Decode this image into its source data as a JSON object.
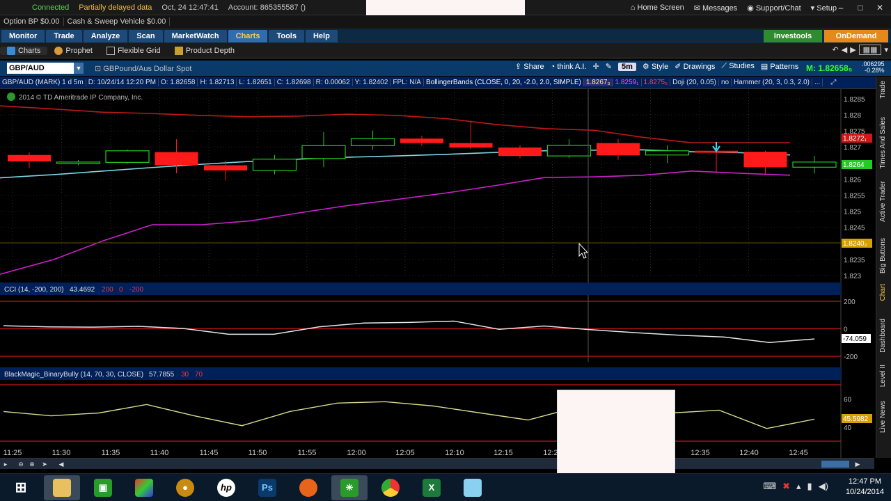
{
  "status": {
    "connected": "Connected",
    "delayed": "Partially delayed data",
    "date_time": "Oct, 24  12:47:41",
    "account": "Account: 865355587 ()",
    "home": "Home Screen",
    "messages": "Messages",
    "support": "Support/Chat",
    "setup": "Setup"
  },
  "account_bar": {
    "option_bp": "Option BP  $0.00",
    "cash_sweep": "Cash & Sweep Vehicle  $0.00"
  },
  "main_tabs": [
    {
      "label": "Monitor"
    },
    {
      "label": "Trade"
    },
    {
      "label": "Analyze"
    },
    {
      "label": "Scan"
    },
    {
      "label": "MarketWatch"
    },
    {
      "label": "Charts"
    },
    {
      "label": "Tools"
    },
    {
      "label": "Help"
    }
  ],
  "investools": "Investools",
  "ondemand": "OnDemand",
  "sub_tabs": [
    {
      "label": "Charts"
    },
    {
      "label": "Prophet"
    },
    {
      "label": "Flexible Grid"
    },
    {
      "label": "Product Depth"
    }
  ],
  "chart_toolbar": {
    "symbol": "GBP/AUD",
    "description": "GBPound/Aus Dollar Spot",
    "share": "Share",
    "think_ai": "think A.I.",
    "timeframe": "5m",
    "style": "Style",
    "drawings": "Drawings",
    "studies": "Studies",
    "patterns": "Patterns",
    "mark": "M: 1.82658₅",
    "change_abs": ".006295",
    "change_pct": "-0.28%"
  },
  "info_bar": {
    "symbol": "GBP/AUD (MARK) 1 d 5m",
    "d": "D: 10/24/14 12:20 PM",
    "o": "O: 1.82658",
    "h": "H: 1.82713",
    "l": "L: 1.82651",
    "c": "C: 1.82698",
    "r": "R: 0.00062",
    "y": "Y: 1.82402",
    "fpl": "FPL: N/A",
    "bb": "BollingerBands (CLOSE, 0, 20, -2.0, 2.0, SIMPLE)",
    "bb1": "1.8267₃",
    "bb2": "1.8259₁",
    "bb3": "1.8275₅",
    "doji": "Doji (20, 0.05)",
    "no": "no",
    "hammer": "Hammer (20, 3, 0.3, 2.0)",
    "more": "..."
  },
  "copyright": "2014 © TD Ameritrade IP Company, Inc.",
  "cci": {
    "label": "CCI (14, -200, 200)",
    "value": "43.4692",
    "v200": "200",
    "v0": "0",
    "vm200": "-200",
    "last": "-74.059",
    "ticks": [
      "200",
      "0",
      "-200"
    ]
  },
  "bbully": {
    "label": "BlackMagic_BinaryBully (14, 70, 30, CLOSE)",
    "value": "57.7855",
    "v30": "30",
    "v70": "70",
    "last": "45.5982",
    "ticks": [
      "60",
      "40"
    ]
  },
  "price_tags": {
    "top": "1.8272₁",
    "mid": "1.8264",
    "low": "1.8240₂"
  },
  "price_ticks": [
    "1.8285",
    "1.828",
    "1.8275",
    "1.827",
    "1.8265",
    "1.826",
    "1.8255",
    "1.825",
    "1.8245",
    "1.824",
    "1.8235",
    "1.823"
  ],
  "time_ticks": [
    "11:25",
    "11:30",
    "11:35",
    "11:40",
    "11:45",
    "11:50",
    "11:55",
    "12:00",
    "12:05",
    "12:10",
    "12:15",
    "12:20",
    "12:35",
    "12:40",
    "12:45"
  ],
  "side_tabs": [
    "Trade",
    "Times And Sales",
    "Active Trader",
    "Big Buttons",
    "Chart",
    "Dashboard",
    "Level II",
    "Live News"
  ],
  "taskbar": {
    "time": "12:47 PM",
    "date": "10/24/2014"
  },
  "chart_data": {
    "type": "candlestick",
    "candles": [
      {
        "t": "11:27",
        "o": 1.82675,
        "c": 1.82655,
        "h": 1.82683,
        "l": 1.82634
      },
      {
        "t": "11:32",
        "o": 1.82651,
        "c": 1.82653,
        "h": 1.82659,
        "l": 1.82643
      },
      {
        "t": "11:37",
        "o": 1.82652,
        "c": 1.82688,
        "h": 1.82692,
        "l": 1.82648
      },
      {
        "t": "11:42",
        "o": 1.82684,
        "c": 1.82643,
        "h": 1.82724,
        "l": 1.82618
      },
      {
        "t": "11:47",
        "o": 1.82643,
        "c": 1.82627,
        "h": 1.82657,
        "l": 1.82596
      },
      {
        "t": "11:52",
        "o": 1.82627,
        "c": 1.82662,
        "h": 1.82675,
        "l": 1.82615
      },
      {
        "t": "11:57",
        "o": 1.82664,
        "c": 1.82704,
        "h": 1.82746,
        "l": 1.82637
      },
      {
        "t": "12:02",
        "o": 1.82704,
        "c": 1.82726,
        "h": 1.82751,
        "l": 1.82692
      },
      {
        "t": "12:07",
        "o": 1.82726,
        "c": 1.82712,
        "h": 1.82735,
        "l": 1.82702
      },
      {
        "t": "12:12",
        "o": 1.82712,
        "c": 1.82698,
        "h": 1.82781,
        "l": 1.82693
      },
      {
        "t": "12:17",
        "o": 1.82698,
        "c": 1.82672,
        "h": 1.82705,
        "l": 1.82665
      },
      {
        "t": "12:22",
        "o": 1.82672,
        "c": 1.82705,
        "h": 1.82725,
        "l": 1.82665
      },
      {
        "t": "12:27",
        "o": 1.82712,
        "c": 1.82674,
        "h": 1.82725,
        "l": 1.8266
      },
      {
        "t": "12:32",
        "o": 1.82675,
        "c": 1.82688,
        "h": 1.82705,
        "l": 1.8265
      },
      {
        "t": "12:37",
        "o": 1.82688,
        "c": 1.82682,
        "h": 1.8271,
        "l": 1.82622
      },
      {
        "t": "12:42",
        "o": 1.82685,
        "c": 1.82637,
        "h": 1.82688,
        "l": 1.82617
      },
      {
        "t": "12:47",
        "o": 1.82637,
        "c": 1.82653,
        "h": 1.82672,
        "l": 1.82617
      }
    ],
    "bb_upper": [
      1.82828,
      1.82818,
      1.82808,
      1.82804,
      1.82798,
      1.82794,
      1.82796,
      1.82802,
      1.82798,
      1.82788,
      1.8277,
      1.82757,
      1.82752,
      1.8273,
      1.82713,
      1.82713,
      1.82713
    ],
    "bb_mid": [
      1.82604,
      1.82614,
      1.82625,
      1.82636,
      1.82646,
      1.82655,
      1.82662,
      1.82668,
      1.82672,
      1.82677,
      1.82683,
      1.82688,
      1.8269,
      1.82691,
      1.82685,
      1.82682,
      1.82675
    ],
    "bb_lower": [
      1.82304,
      1.8235,
      1.82408,
      1.82458,
      1.82458,
      1.8247,
      1.82495,
      1.82518,
      1.82537,
      1.82557,
      1.8258,
      1.82605,
      1.82607,
      1.82612,
      1.82625,
      1.82618,
      1.82612
    ],
    "ylim": [
      1.823,
      1.8288
    ],
    "cci": [
      22,
      14,
      12,
      18,
      2,
      -40,
      -40,
      14,
      42,
      46,
      56,
      -4,
      20,
      -6,
      -28,
      -47,
      -60,
      -100,
      -74
    ],
    "cci_ylim": [
      -200,
      200
    ],
    "bully": [
      51,
      48,
      50,
      56,
      48,
      41,
      51,
      57,
      58,
      55,
      50,
      45,
      54,
      51,
      50,
      52,
      39,
      45.6
    ],
    "bully_ylim": [
      30,
      70
    ]
  }
}
